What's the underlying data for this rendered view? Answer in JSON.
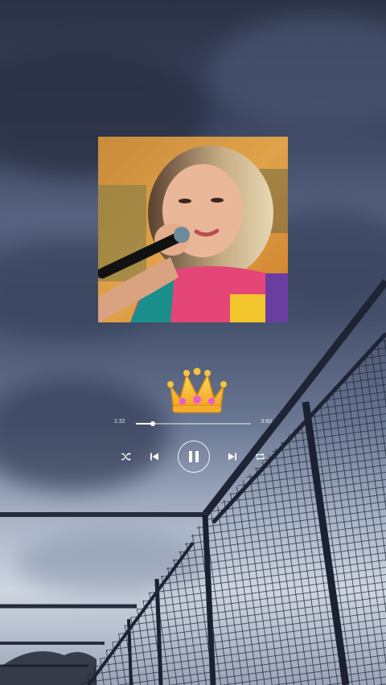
{
  "player": {
    "current_time": "1:32",
    "total_time": "3:60",
    "progress": 0.15,
    "state": "playing"
  },
  "icons": {
    "artwork": "album-artwork",
    "emoji": "crown-emoji",
    "shuffle": "shuffle-icon",
    "previous": "previous-track-icon",
    "pause": "pause-icon",
    "next": "next-track-icon",
    "repeat": "repeat-icon"
  },
  "colors": {
    "controls": "#ffffff",
    "crown_gold": "#f5b82e",
    "crown_gem": "#e85bd6"
  }
}
